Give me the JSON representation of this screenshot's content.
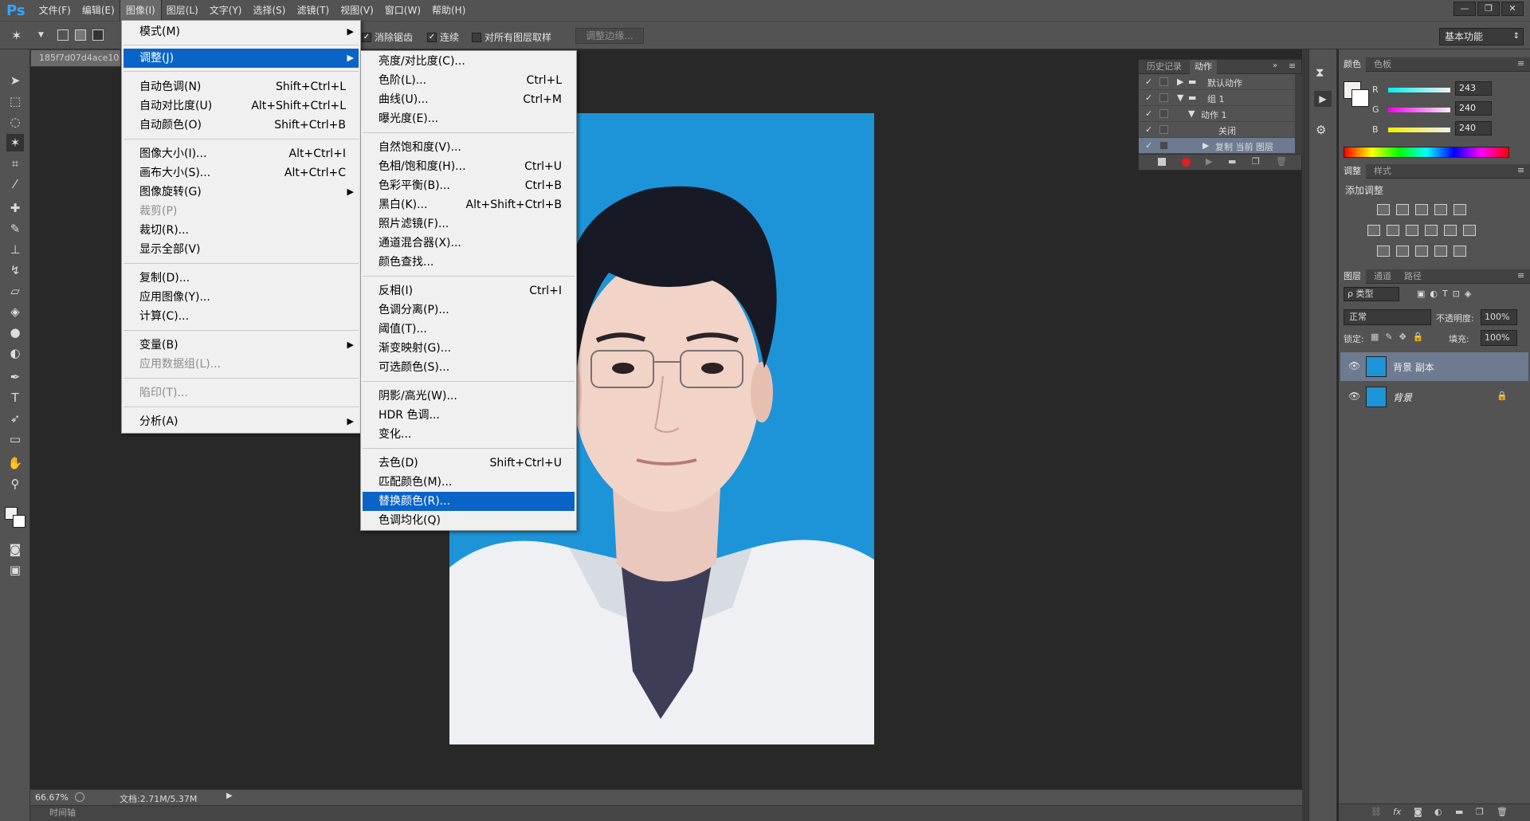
{
  "app": {
    "logo": "Ps"
  },
  "menubar": [
    {
      "label": "文件(F)"
    },
    {
      "label": "编辑(E)"
    },
    {
      "label": "图像(I)"
    },
    {
      "label": "图层(L)"
    },
    {
      "label": "文字(Y)"
    },
    {
      "label": "选择(S)"
    },
    {
      "label": "滤镜(T)"
    },
    {
      "label": "视图(V)"
    },
    {
      "label": "窗口(W)"
    },
    {
      "label": "帮助(H)"
    }
  ],
  "window_controls": {
    "minimize": "—",
    "restore": "❐",
    "close": "✕"
  },
  "options_bar": {
    "antialias": "消除锯齿",
    "contiguous": "连续",
    "sample_all": "对所有图层取样",
    "refine_edge": "调整边缘...",
    "workspace": "基本功能"
  },
  "document": {
    "tab_title": "185f7d07d4ace10",
    "zoom": "66.67%",
    "doc_size": "文档:2.71M/5.37M",
    "timeline_label": "时间轴"
  },
  "image_menu": {
    "items": [
      {
        "label": "模式(M)",
        "shortcut": "",
        "submenu": true
      },
      {
        "label": "调整(J)",
        "shortcut": "",
        "submenu": true,
        "highlight": true
      },
      {
        "label": "自动色调(N)",
        "shortcut": "Shift+Ctrl+L"
      },
      {
        "label": "自动对比度(U)",
        "shortcut": "Alt+Shift+Ctrl+L"
      },
      {
        "label": "自动颜色(O)",
        "shortcut": "Shift+Ctrl+B"
      },
      {
        "label": "图像大小(I)...",
        "shortcut": "Alt+Ctrl+I"
      },
      {
        "label": "画布大小(S)...",
        "shortcut": "Alt+Ctrl+C"
      },
      {
        "label": "图像旋转(G)",
        "shortcut": "",
        "submenu": true
      },
      {
        "label": "裁剪(P)",
        "shortcut": "",
        "disabled": true
      },
      {
        "label": "裁切(R)...",
        "shortcut": ""
      },
      {
        "label": "显示全部(V)",
        "shortcut": ""
      },
      {
        "label": "复制(D)...",
        "shortcut": ""
      },
      {
        "label": "应用图像(Y)...",
        "shortcut": ""
      },
      {
        "label": "计算(C)...",
        "shortcut": ""
      },
      {
        "label": "变量(B)",
        "shortcut": "",
        "submenu": true
      },
      {
        "label": "应用数据组(L)...",
        "shortcut": "",
        "disabled": true
      },
      {
        "label": "陷印(T)...",
        "shortcut": "",
        "disabled": true
      },
      {
        "label": "分析(A)",
        "shortcut": "",
        "submenu": true
      }
    ]
  },
  "adjust_menu": {
    "items": [
      {
        "label": "亮度/对比度(C)...",
        "shortcut": ""
      },
      {
        "label": "色阶(L)...",
        "shortcut": "Ctrl+L"
      },
      {
        "label": "曲线(U)...",
        "shortcut": "Ctrl+M"
      },
      {
        "label": "曝光度(E)...",
        "shortcut": ""
      },
      {
        "label": "自然饱和度(V)...",
        "shortcut": ""
      },
      {
        "label": "色相/饱和度(H)...",
        "shortcut": "Ctrl+U"
      },
      {
        "label": "色彩平衡(B)...",
        "shortcut": "Ctrl+B"
      },
      {
        "label": "黑白(K)...",
        "shortcut": "Alt+Shift+Ctrl+B"
      },
      {
        "label": "照片滤镜(F)...",
        "shortcut": ""
      },
      {
        "label": "通道混合器(X)...",
        "shortcut": ""
      },
      {
        "label": "颜色查找...",
        "shortcut": ""
      },
      {
        "label": "反相(I)",
        "shortcut": "Ctrl+I"
      },
      {
        "label": "色调分离(P)...",
        "shortcut": ""
      },
      {
        "label": "阈值(T)...",
        "shortcut": ""
      },
      {
        "label": "渐变映射(G)...",
        "shortcut": ""
      },
      {
        "label": "可选颜色(S)...",
        "shortcut": ""
      },
      {
        "label": "阴影/高光(W)...",
        "shortcut": ""
      },
      {
        "label": "HDR 色调...",
        "shortcut": ""
      },
      {
        "label": "变化...",
        "shortcut": ""
      },
      {
        "label": "去色(D)",
        "shortcut": "Shift+Ctrl+U"
      },
      {
        "label": "匹配颜色(M)...",
        "shortcut": ""
      },
      {
        "label": "替换颜色(R)...",
        "shortcut": "",
        "highlight": true
      },
      {
        "label": "色调均化(Q)",
        "shortcut": ""
      }
    ]
  },
  "actions_panel": {
    "tabs": [
      "历史记录",
      "动作"
    ],
    "rows": [
      "默认动作",
      "组 1",
      "动作 1",
      "关闭",
      "复制 当前 图层"
    ]
  },
  "color_panel": {
    "tabs": [
      "颜色",
      "色板"
    ],
    "r_label": "R",
    "g_label": "G",
    "b_label": "B",
    "r": "243",
    "g": "240",
    "b": "240",
    "fg_color": "#f3f0f0"
  },
  "adjustments_panel": {
    "tabs": [
      "调整",
      "样式"
    ],
    "title": "添加调整"
  },
  "layers_panel": {
    "tabs": [
      "图层",
      "通道",
      "路径"
    ],
    "filter": "ρ 类型",
    "blend_mode": "正常",
    "opacity_label": "不透明度:",
    "opacity": "100%",
    "lock_label": "锁定:",
    "fill_label": "填充:",
    "fill": "100%",
    "layers": [
      {
        "name": "背景 副本",
        "selected": true
      },
      {
        "name": "背景",
        "locked": true
      }
    ]
  },
  "colors": {
    "accent": "#0a64c8",
    "photo_bg": "#1d94d8",
    "ui_bg": "#535353"
  }
}
